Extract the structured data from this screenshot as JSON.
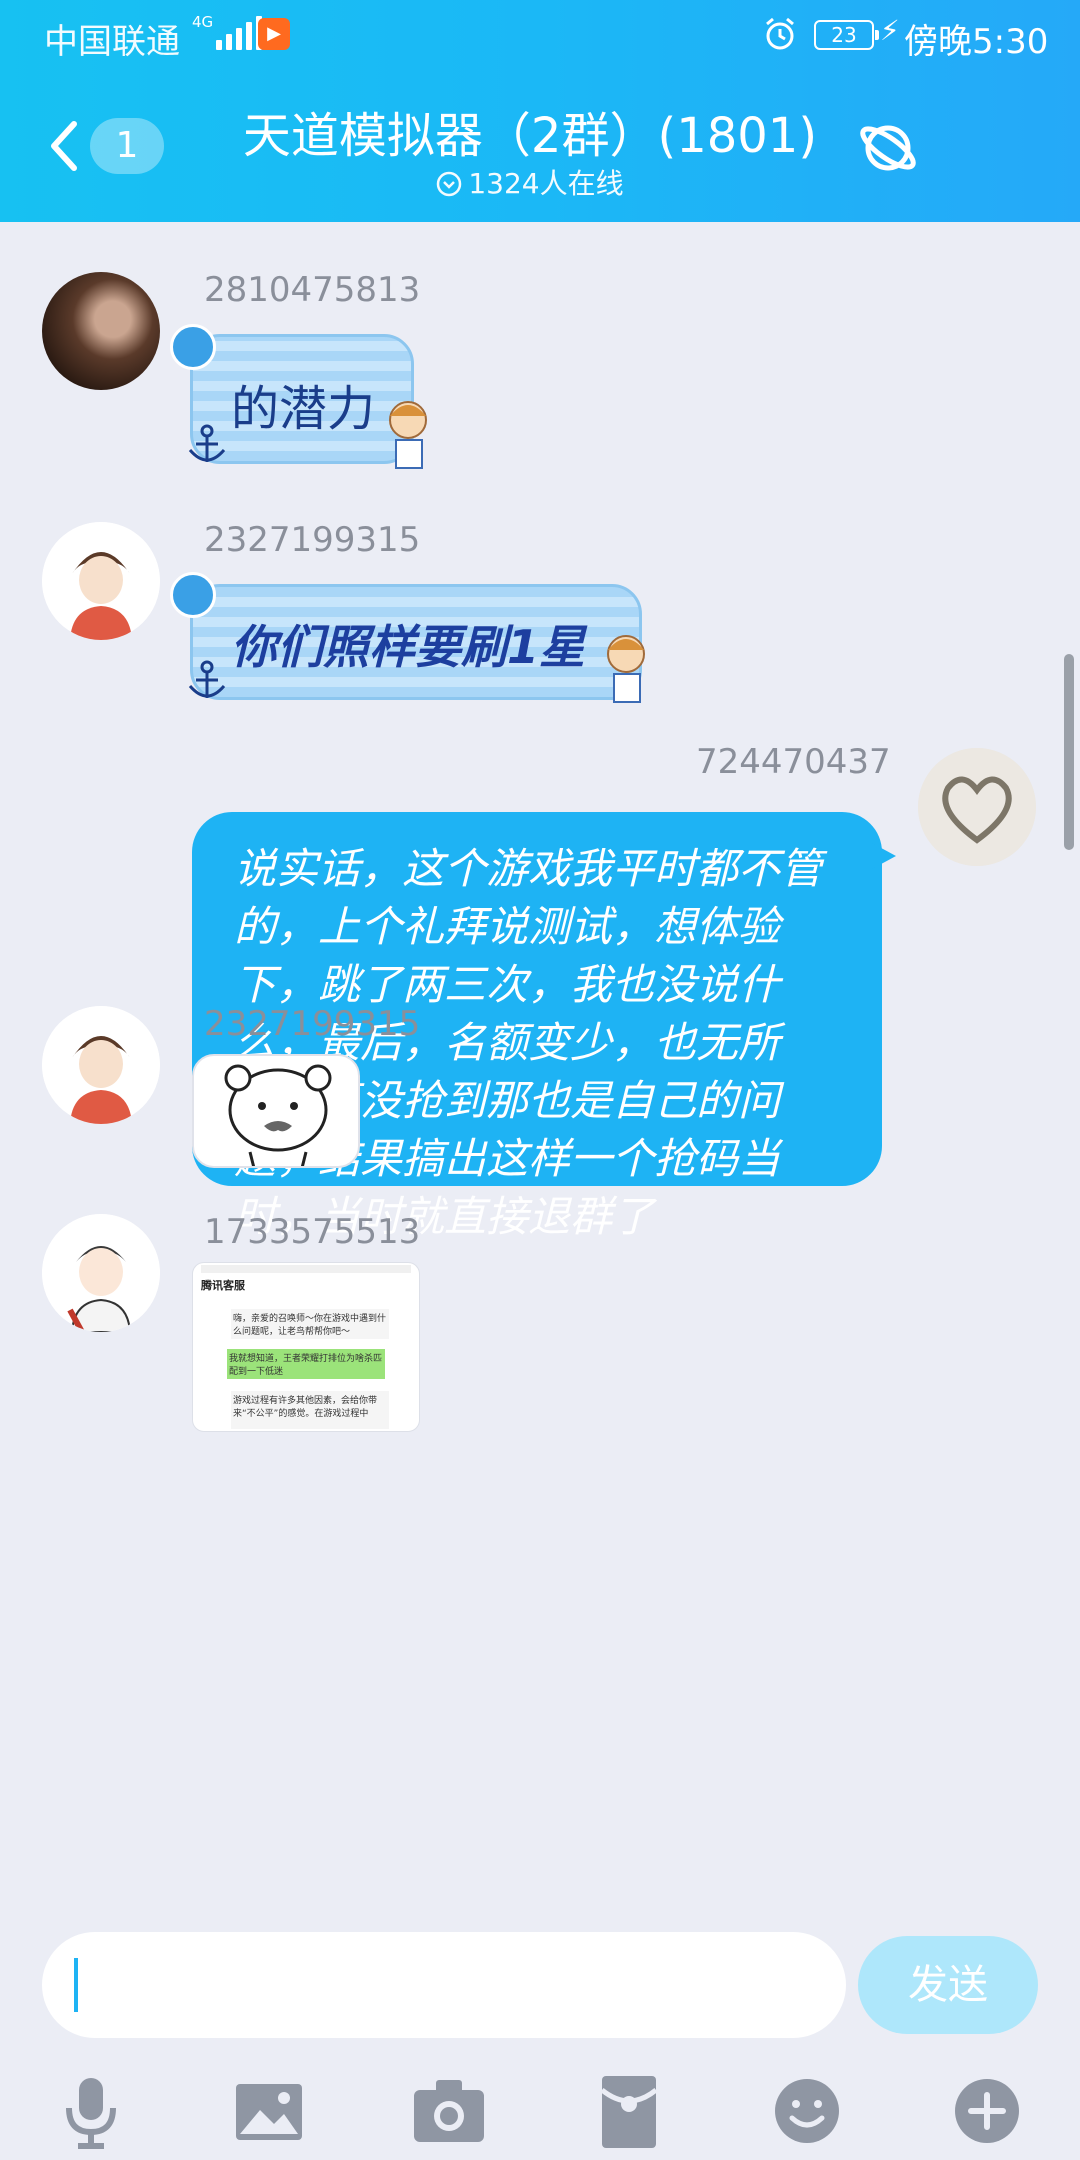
{
  "status_bar": {
    "carrier": "中国联通",
    "network": "4G",
    "battery": "23",
    "time": "傍晚5:30"
  },
  "header": {
    "unread_count": "1",
    "title": "天道模拟器（2群）(1801)",
    "online": "1324人在线"
  },
  "messages": [
    {
      "sender": "2810475813",
      "text": "的潜力"
    },
    {
      "sender": "2327199315",
      "text": "你们照样要刷1星"
    },
    {
      "sender": "724470437",
      "text": "说实话，这个游戏我平时都不管的，上个礼拜说测试，想体验下，跳了两三次，我也没说什么，最后，名额变少，也无所谓，真没抢到那也是自己的问题，结果搞出这样一个抢码当时，当时就直接退群了"
    },
    {
      "sender": "2327199315",
      "text": ""
    },
    {
      "sender": "1733575513",
      "text": ""
    }
  ],
  "screenshot_card": {
    "title": "腾讯客服",
    "lines": [
      "嗨，亲爱的召唤师～你在游戏中遇到什么问题呢，让老鸟帮帮你吧～",
      "我就想知道，王者荣耀打排位为啥杀匹配到一下低迷",
      "游戏过程有许多其他因素，会给你带来“不公平”的感觉。在游戏过程中"
    ]
  },
  "input": {
    "send_label": "发送"
  },
  "colors": {
    "header": "#1bb8f6",
    "own_bubble": "#1eb3f4",
    "background": "#ebedf5",
    "send_disabled": "#aee7fb"
  },
  "icons": [
    "back-icon",
    "planet-icon",
    "mic-icon",
    "image-icon",
    "camera-icon",
    "red-packet-icon",
    "emoji-icon",
    "plus-icon"
  ]
}
